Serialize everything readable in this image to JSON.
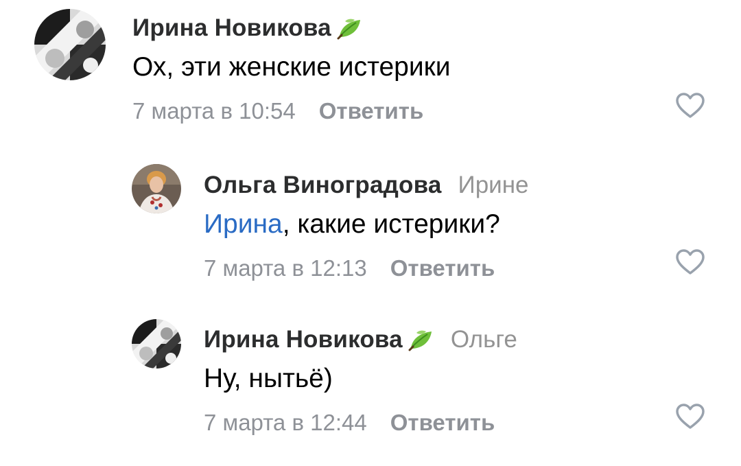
{
  "comments": [
    {
      "author": "Ирина Новикова",
      "badge_icon": "leaf-icon",
      "reply_to": "",
      "mention": "",
      "text": "Ох, эти женские истерики",
      "date": "7 марта в 10:54",
      "reply_label": "Ответить",
      "like_icon": "heart-outline-icon"
    },
    {
      "author": "Ольга Виноградова",
      "reply_to": "Ирине",
      "mention": "Ирина",
      "text": ", какие истерики?",
      "date": "7 марта в 12:13",
      "reply_label": "Ответить",
      "like_icon": "heart-outline-icon"
    },
    {
      "author": "Ирина Новикова",
      "badge_icon": "leaf-icon",
      "reply_to": "Ольге",
      "mention": "",
      "text": "Ну, нытьё)",
      "date": "7 марта в 12:44",
      "reply_label": "Ответить",
      "like_icon": "heart-outline-icon"
    }
  ],
  "colors": {
    "author": "#2c2d2e",
    "secondary": "#8e9197",
    "mention": "#2a6bc4",
    "leaf": "#6fbf3a"
  }
}
